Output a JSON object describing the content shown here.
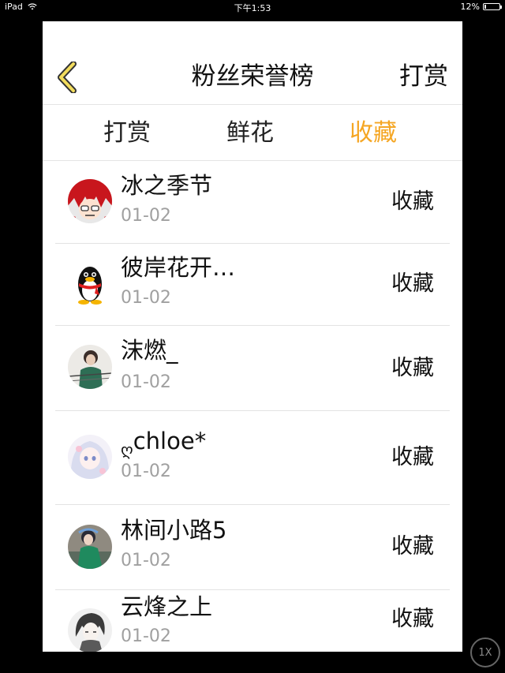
{
  "status_bar": {
    "device": "iPad",
    "time": "下午1:53",
    "battery": "12%",
    "battery_level": 0.12
  },
  "nav": {
    "title": "粉丝荣誉榜",
    "right_label": "打赏",
    "accent": "#f5a623"
  },
  "tabs": [
    {
      "label": "打赏",
      "active": false
    },
    {
      "label": "鲜花",
      "active": false
    },
    {
      "label": "收藏",
      "active": true
    }
  ],
  "items": [
    {
      "name": "冰之季节",
      "date": "01-02",
      "action": "收藏",
      "avatar": "red-hair-anime-avatar"
    },
    {
      "name": "彼岸花开…",
      "date": "01-02",
      "action": "收藏",
      "avatar": "qq-penguin-avatar"
    },
    {
      "name": "沫燃_",
      "date": "01-02",
      "action": "收藏",
      "avatar": "person-green-jacket-avatar"
    },
    {
      "name": "chloe*",
      "name_prefix": "ღ",
      "date": "01-02",
      "action": "收藏",
      "avatar": "anime-girl-pastel-avatar"
    },
    {
      "name": "林间小路5",
      "date": "01-02",
      "action": "收藏",
      "avatar": "person-green-dress-avatar"
    },
    {
      "name": "云烽之上",
      "date": "01-02",
      "action": "收藏",
      "avatar": "gray-anime-boy-avatar"
    }
  ],
  "zoom": {
    "label": "1X"
  }
}
